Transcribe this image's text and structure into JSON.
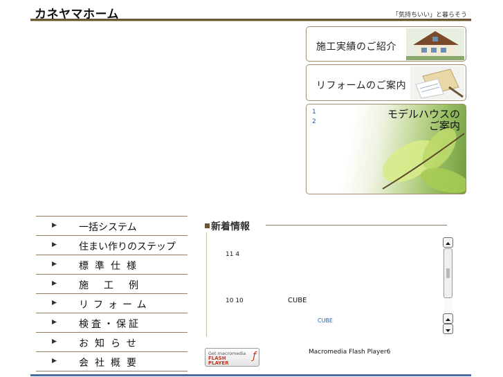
{
  "header": {
    "logo": "カネヤマホーム",
    "tagline": "「気持ちいい」と暮らそう"
  },
  "banners": [
    {
      "label": "施工実績のご紹介"
    },
    {
      "label": "リフォームのご案内"
    },
    {
      "label_line1": "モデルハウスの",
      "label_line2": "ご案内",
      "slides": [
        "1",
        "2"
      ]
    }
  ],
  "nav": {
    "items": [
      {
        "label": "一括システム"
      },
      {
        "label": "住まい作りのステップ"
      },
      {
        "label": "標準仕様"
      },
      {
        "label": "施工例"
      },
      {
        "label": "リフォーム"
      },
      {
        "label": "検査・保証"
      },
      {
        "label": "お知らせ"
      },
      {
        "label": "会社概要"
      }
    ]
  },
  "news": {
    "title": "新着情報",
    "entries": [
      {
        "date": "11 4"
      },
      {
        "date": "10 10",
        "text": "CUBE",
        "link": "CUBE"
      }
    ]
  },
  "flash": {
    "badge_line1": "Get macromedia",
    "badge_line2": "FLASH",
    "badge_line3": "PLAYER",
    "note": "Macromedia Flash Player6"
  },
  "colors": {
    "brown_rule": "#6b5637",
    "blue_rule": "#4a6aa0",
    "link_blue": "#1a5fb4"
  }
}
